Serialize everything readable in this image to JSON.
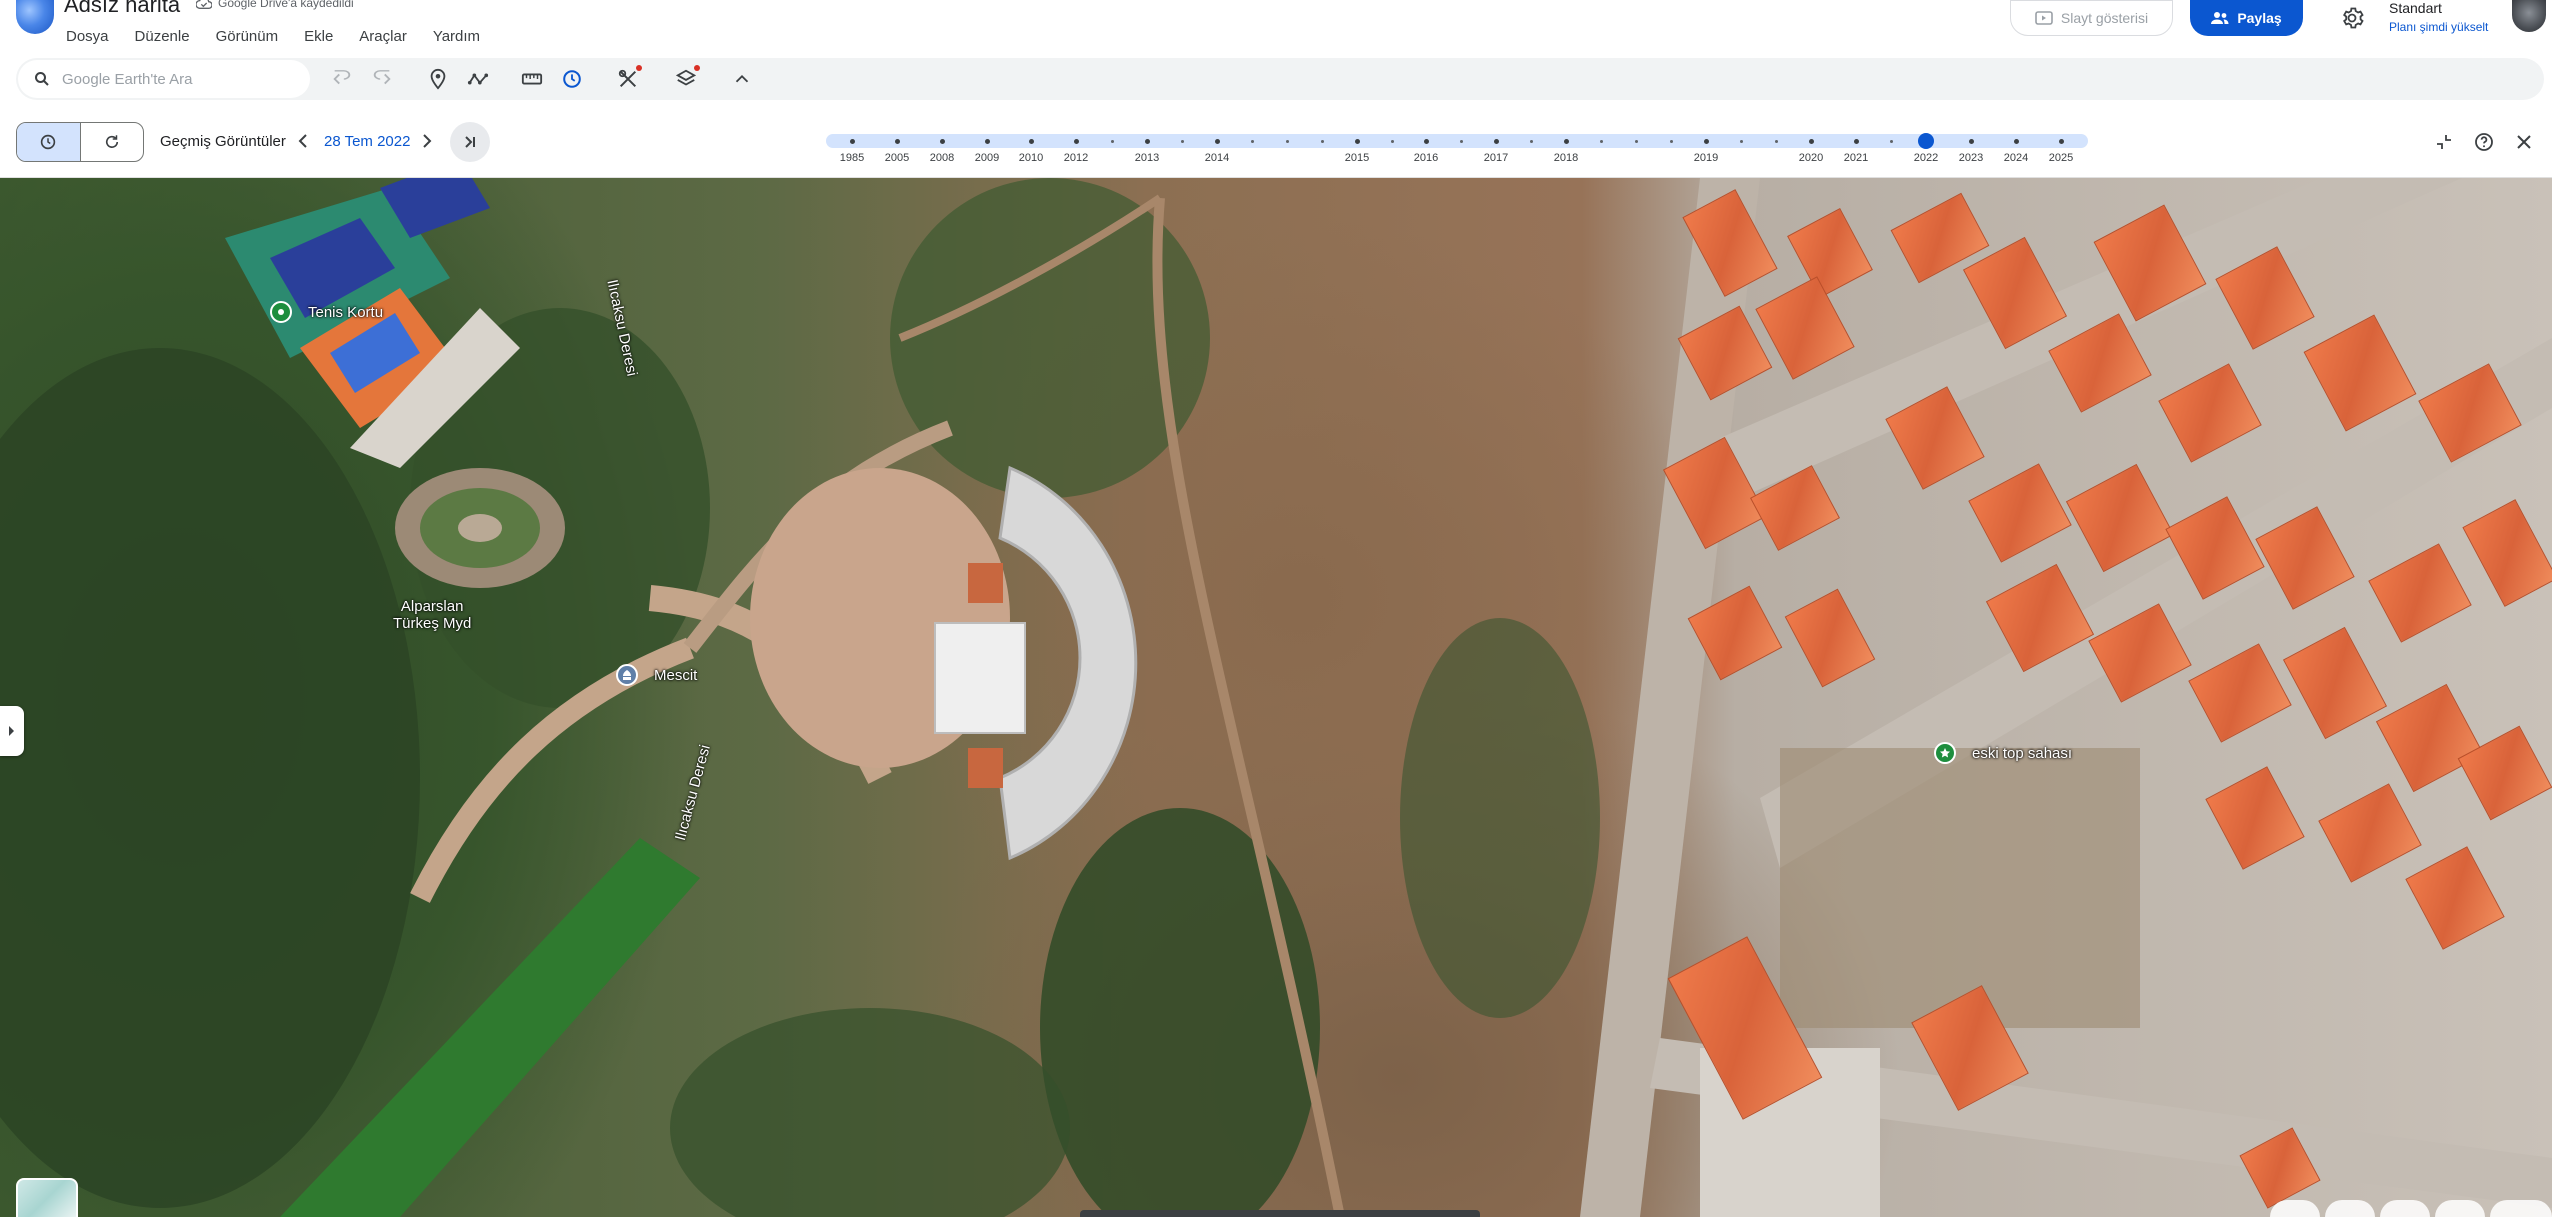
{
  "app": {
    "title": "Adsız harita",
    "drive_status": "Google Drive'a kaydedildi"
  },
  "menu": [
    "Dosya",
    "Düzenle",
    "Görünüm",
    "Ekle",
    "Araçlar",
    "Yardım"
  ],
  "header": {
    "slideshow_label": "Slayt gösterisi",
    "share_label": "Paylaş",
    "plan_name": "Standart",
    "plan_upgrade": "Planı şimdi yükselt"
  },
  "search": {
    "placeholder": "Google Earth'te Ara"
  },
  "history": {
    "label": "Geçmiş Görüntüler",
    "current_date": "28 Tem 2022",
    "years": [
      "1985",
      "2005",
      "2008",
      "2009",
      "2010",
      "2012",
      "2013",
      "2014",
      "2015",
      "2016",
      "2017",
      "2018",
      "2019",
      "2020",
      "2021",
      "2022",
      "2023",
      "2024",
      "2025"
    ],
    "selected_year": "2022"
  },
  "map": {
    "places": {
      "tennis": "Tenis Kortu",
      "park_line1": "Alparslan",
      "park_line2": "Türkeş Myd",
      "mosque": "Mescit",
      "field": "eski top sahası",
      "river_top": "Ilıcaksu Deresi",
      "river_bottom": "Ilıcaksu Deresi"
    }
  },
  "colors": {
    "accent": "#0b57d0",
    "timeline_track": "#d3e3fd",
    "pin_green": "#1e8e3e"
  }
}
